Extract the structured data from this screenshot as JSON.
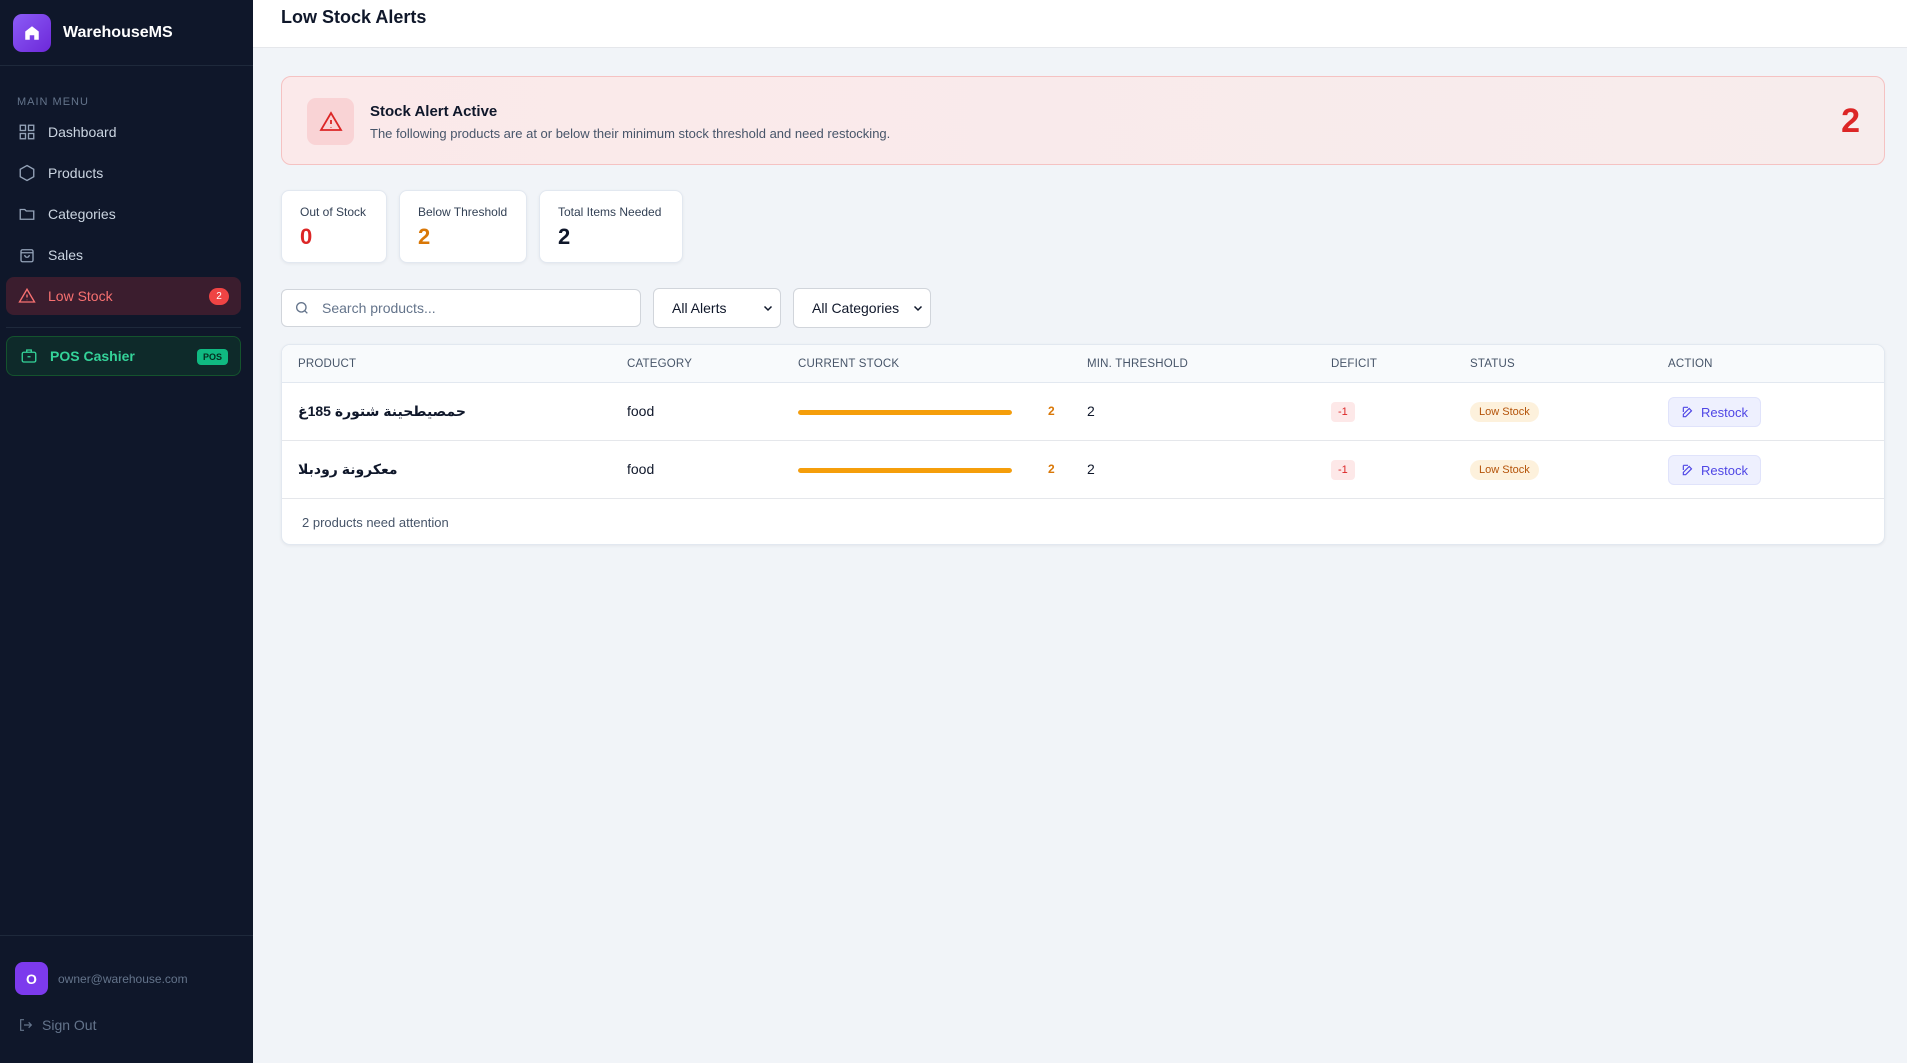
{
  "app": {
    "name": "WarehouseMS",
    "logo_icon": "home-icon"
  },
  "sidebar": {
    "menu_title": "MAIN MENU",
    "items": [
      {
        "label": "Dashboard",
        "icon": "grid-icon"
      },
      {
        "label": "Products",
        "icon": "hexagon-icon"
      },
      {
        "label": "Categories",
        "icon": "folder-icon"
      },
      {
        "label": "Sales",
        "icon": "shopping-bag-icon"
      },
      {
        "label": "Low Stock",
        "icon": "alert-triangle-icon",
        "badge": "2",
        "active": true
      }
    ],
    "pos": {
      "label": "POS Cashier",
      "badge": "POS",
      "icon": "briefcase-icon"
    },
    "user": {
      "initial": "O",
      "email": "owner@warehouse.com"
    },
    "sign_out": "Sign Out"
  },
  "header": {
    "title": "Low Stock Alerts"
  },
  "alert": {
    "title": "Stock Alert Active",
    "description": "The following products are at or below their minimum stock threshold and need restocking.",
    "count": "2",
    "icon": "alert-triangle-icon"
  },
  "stats": [
    {
      "label": "Out of Stock",
      "value": "0",
      "color": "#dc2626"
    },
    {
      "label": "Below Threshold",
      "value": "2",
      "color": "#d97706"
    },
    {
      "label": "Total Items Needed",
      "value": "2",
      "color": "#0f172a"
    }
  ],
  "filters": {
    "search_placeholder": "Search products...",
    "alerts_select": "All Alerts",
    "categories_select": "All Categories"
  },
  "table": {
    "headers": [
      "PRODUCT",
      "CATEGORY",
      "CURRENT STOCK",
      "MIN. THRESHOLD",
      "DEFICIT",
      "STATUS",
      "ACTION"
    ],
    "rows": [
      {
        "product": "حمصيطحينة شتورة 185غ",
        "category": "food",
        "stock": "2",
        "stock_level": 1.0,
        "threshold": "2",
        "deficit": "-1",
        "status": "Low Stock",
        "action": "Restock"
      },
      {
        "product": "معكرونة رودبلا",
        "category": "food",
        "stock": "2",
        "stock_level": 1.0,
        "threshold": "2",
        "deficit": "-1",
        "status": "Low Stock",
        "action": "Restock"
      }
    ],
    "footer": "2 products need attention"
  },
  "colors": {
    "accent": "#7c3aed",
    "danger": "#dc2626",
    "warning": "#f59e0b",
    "success": "#10b981",
    "sidebar_bg": "#0f172a"
  }
}
